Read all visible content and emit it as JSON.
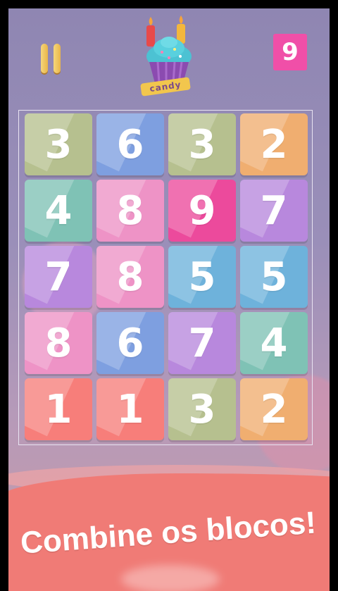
{
  "hud": {
    "pause_icon": "pause-icon",
    "logo_text": "candy",
    "level_value": "9"
  },
  "board": {
    "rows": [
      [
        {
          "value": "3",
          "color": "#b6c08f"
        },
        {
          "value": "6",
          "color": "#7e9fe0"
        },
        {
          "value": "3",
          "color": "#b6c08f"
        },
        {
          "value": "2",
          "color": "#f0ae70"
        }
      ],
      [
        {
          "value": "4",
          "color": "#7fc2b5"
        },
        {
          "value": "8",
          "color": "#ee93c6"
        },
        {
          "value": "9",
          "color": "#ec4a9c"
        },
        {
          "value": "7",
          "color": "#b888dd"
        }
      ],
      [
        {
          "value": "7",
          "color": "#b888dd"
        },
        {
          "value": "8",
          "color": "#ee93c6"
        },
        {
          "value": "5",
          "color": "#6eb2db"
        },
        {
          "value": "5",
          "color": "#6eb2db"
        }
      ],
      [
        {
          "value": "8",
          "color": "#ee93c6"
        },
        {
          "value": "6",
          "color": "#7e9fe0"
        },
        {
          "value": "7",
          "color": "#b888dd"
        },
        {
          "value": "4",
          "color": "#7fc2b5"
        }
      ],
      [
        {
          "value": "1",
          "color": "#f77e7a"
        },
        {
          "value": "1",
          "color": "#f77e7a"
        },
        {
          "value": "3",
          "color": "#b6c08f"
        },
        {
          "value": "2",
          "color": "#f0ae70"
        }
      ]
    ]
  },
  "banner": {
    "text": "Combine os blocos!"
  },
  "colors": {
    "background": "#9a8fb9",
    "level_badge": "#f04fa8",
    "banner_wave": "#f07b76"
  }
}
